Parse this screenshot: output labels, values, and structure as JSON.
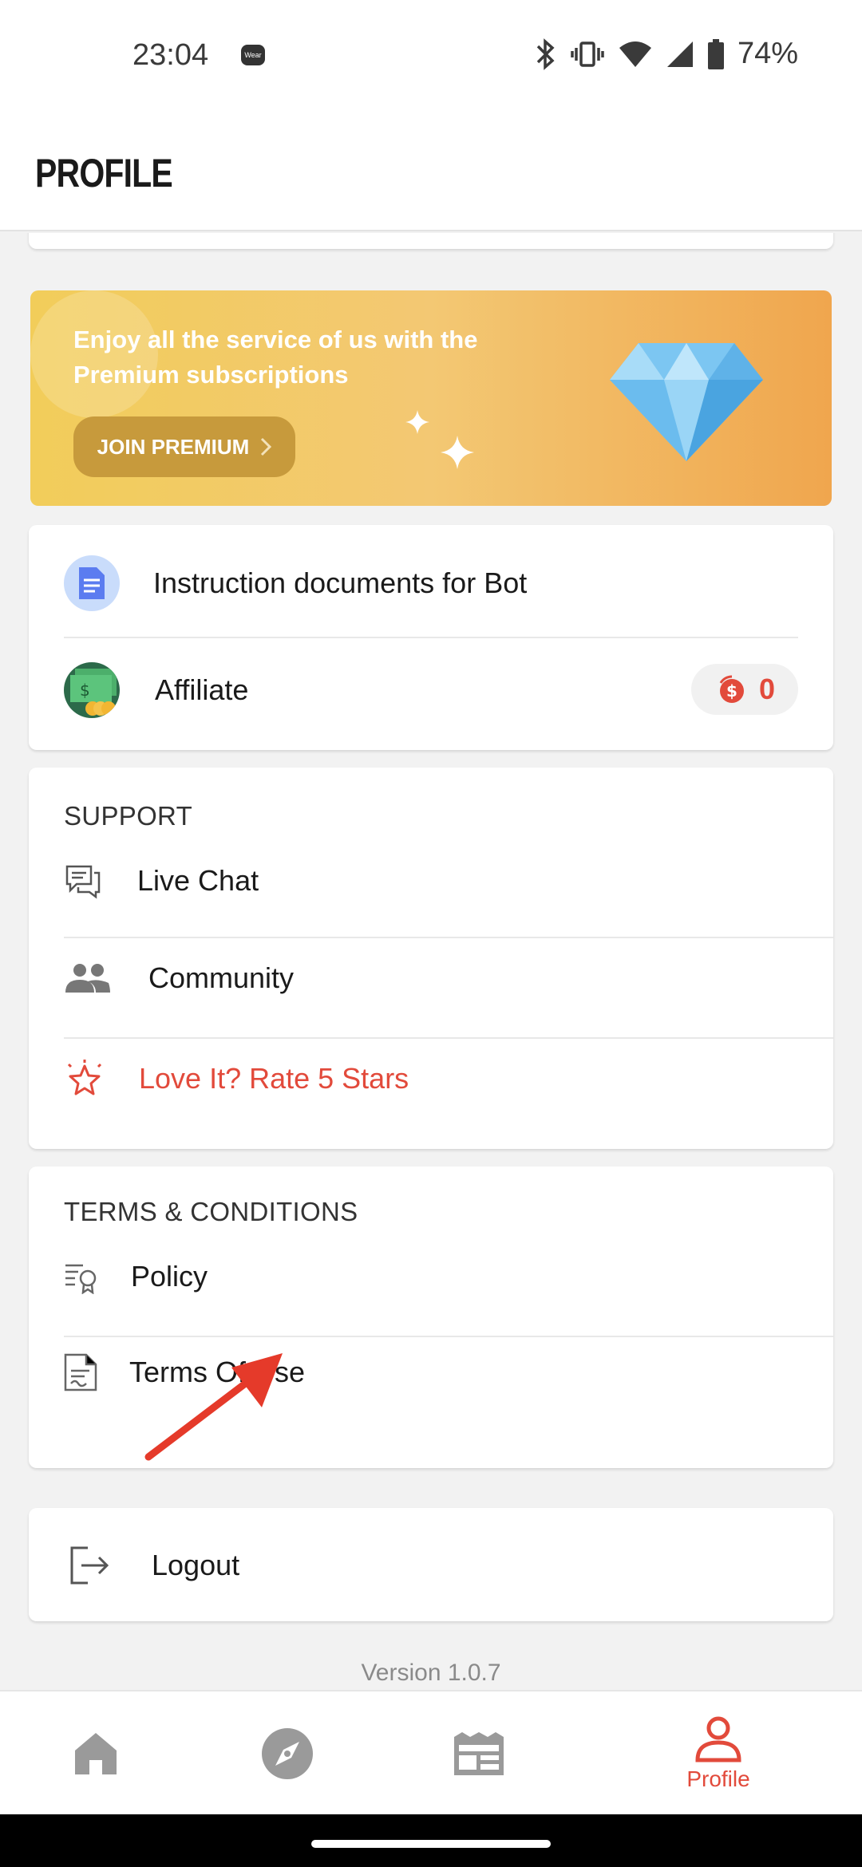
{
  "status_bar": {
    "time": "23:04",
    "wear_badge": "Wear",
    "battery": "74%",
    "icons": [
      "bluetooth-icon",
      "vibrate-icon",
      "wifi-icon",
      "signal-icon",
      "battery-icon"
    ]
  },
  "header": {
    "title": "PROFILE"
  },
  "premium_banner": {
    "text": "Enjoy all the service of us with the Premium subscriptions",
    "button_label": "JOIN PREMIUM",
    "icon": "diamond-icon"
  },
  "links": {
    "items": [
      {
        "label": "Instruction documents for Bot",
        "icon": "document-icon"
      },
      {
        "label": "Affiliate",
        "icon": "money-icon",
        "badge_count": "0"
      }
    ]
  },
  "support": {
    "title": "SUPPORT",
    "items": [
      {
        "label": "Live Chat",
        "icon": "chat-icon"
      },
      {
        "label": "Community",
        "icon": "people-icon"
      },
      {
        "label": "Love It? Rate 5 Stars",
        "icon": "star-icon"
      }
    ]
  },
  "terms": {
    "title": "TERMS & CONDITIONS",
    "items": [
      {
        "label": "Policy",
        "icon": "policy-icon"
      },
      {
        "label": "Terms Of Use",
        "icon": "terms-icon"
      }
    ]
  },
  "logout": {
    "label": "Logout",
    "icon": "logout-icon"
  },
  "version": "Version 1.0.7",
  "bottom_nav": {
    "items": [
      {
        "name": "home",
        "icon": "home-icon",
        "label": ""
      },
      {
        "name": "explore",
        "icon": "compass-icon",
        "label": ""
      },
      {
        "name": "feed",
        "icon": "newspaper-icon",
        "label": ""
      },
      {
        "name": "profile",
        "icon": "person-icon",
        "label": "Profile",
        "active": true
      }
    ]
  },
  "colors": {
    "accent": "#e24a3b",
    "banner_start": "#f2cd5a",
    "banner_end": "#f0a64e",
    "inactive_icon": "#9a9a9a"
  }
}
